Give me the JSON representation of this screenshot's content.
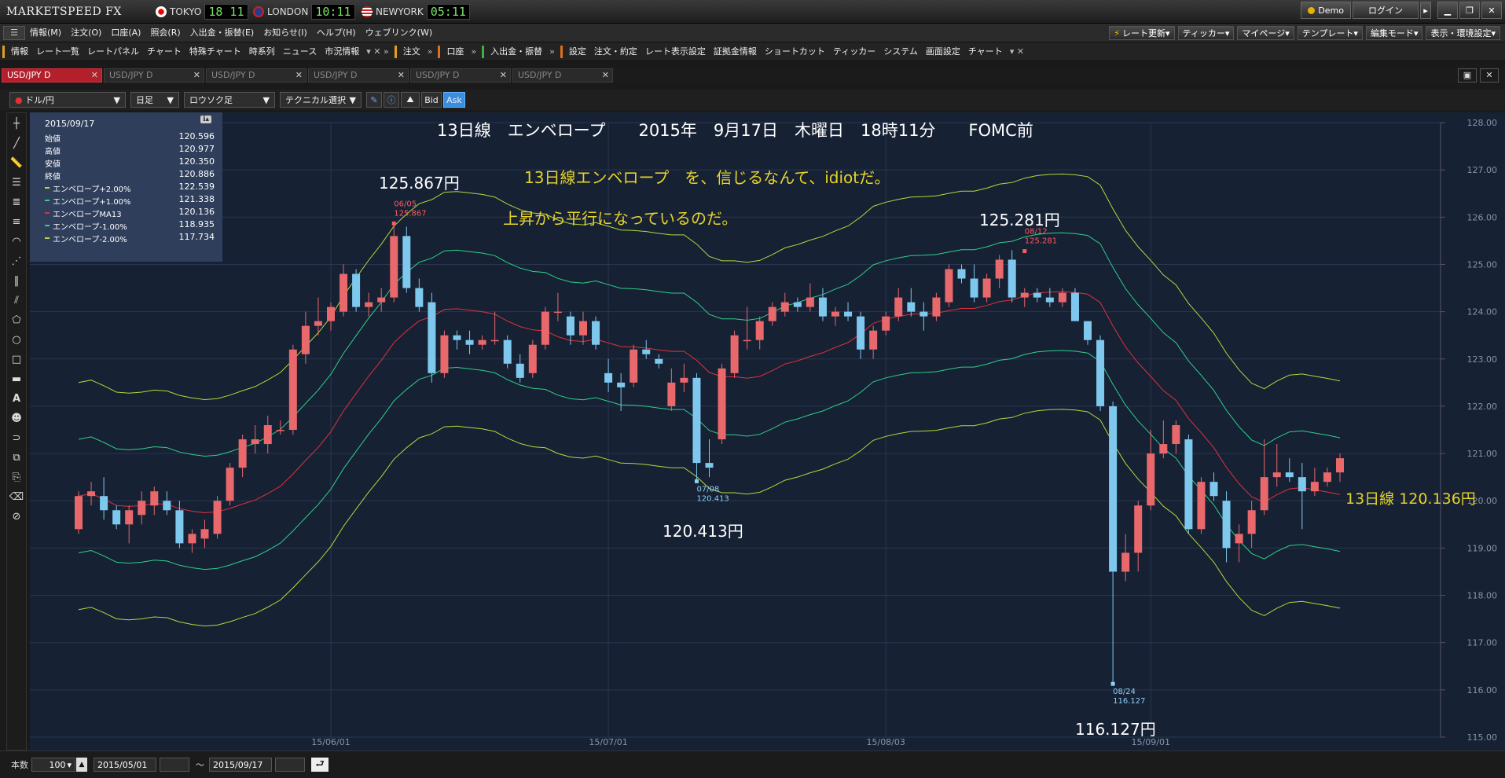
{
  "app": {
    "logo": "MARKETSPEED FX",
    "clocks": [
      {
        "city": "TOKYO",
        "time": "18 11"
      },
      {
        "city": "LONDON",
        "time": "10:11"
      },
      {
        "city": "NEWYORK",
        "time": "05:11"
      }
    ],
    "demo_label": "Demo",
    "login_label": "ログイン"
  },
  "menu": {
    "items": [
      "情報(M)",
      "注文(O)",
      "口座(A)",
      "照会(R)",
      "入出金・振替(E)",
      "お知らせ(I)",
      "ヘルプ(H)",
      "ウェブリンク(W)"
    ],
    "right_buttons": [
      "レート更新",
      "ティッカー",
      "マイページ",
      "テンプレート",
      "編集モード",
      "表示・環境設定"
    ]
  },
  "toolbar": {
    "groups": [
      {
        "color": "#e0a020",
        "items": [
          "情報",
          "レート一覧",
          "レートパネル",
          "チャート",
          "特殊チャート",
          "時系列",
          "ニュース",
          "市況情報"
        ]
      },
      {
        "color": "#e0a020",
        "items": [
          "注文"
        ]
      },
      {
        "color": "#e07020",
        "items": [
          "口座"
        ]
      },
      {
        "color": "#3cb043",
        "items": [
          "入出金・振替"
        ]
      },
      {
        "color": "#e07020",
        "items": [
          "設定",
          "注文・約定",
          "レート表示設定",
          "証拠金情報",
          "ショートカット",
          "ティッカー",
          "システム",
          "画面設定",
          "チャート"
        ]
      }
    ]
  },
  "tabs": [
    "USD/JPY D",
    "USD/JPY D",
    "USD/JPY D",
    "USD/JPY D",
    "USD/JPY D",
    "USD/JPY D"
  ],
  "chart_toolbar": {
    "pair": "ドル/円",
    "timeframe": "日足",
    "chart_style": "ロウソク足",
    "technical": "テクニカル選択",
    "bid": "Bid",
    "ask": "Ask"
  },
  "info_panel": {
    "date": "2015/09/17",
    "rows": [
      {
        "label": "始値",
        "value": "120.596",
        "color": ""
      },
      {
        "label": "高値",
        "value": "120.977",
        "color": ""
      },
      {
        "label": "安値",
        "value": "120.350",
        "color": ""
      },
      {
        "label": "終値",
        "value": "120.886",
        "color": ""
      },
      {
        "label": "エンベロープ+2.00%",
        "value": "122.539",
        "color": "#b5d83a"
      },
      {
        "label": "エンベロープ+1.00%",
        "value": "121.338",
        "color": "#2ed08a"
      },
      {
        "label": "エンベロープMA13",
        "value": "120.136",
        "color": "#e0303c"
      },
      {
        "label": "エンベロープ-1.00%",
        "value": "118.935",
        "color": "#2ed08a"
      },
      {
        "label": "エンベロープ-2.00%",
        "value": "117.734",
        "color": "#b5d83a"
      }
    ]
  },
  "annotations": {
    "title": "13日線　エンベロープ　　2015年　9月17日　木曜日　18時11分　　FOMC前",
    "comment1": "13日線エンベロープ　を、信じるなんて、idiotだ。",
    "comment2": "上昇から平行になっているのだ。",
    "high1": "125.867円",
    "high2": "125.281円",
    "low1": "120.413円",
    "low2": "116.127円",
    "ma_label": "13日線 120.136円",
    "marker_high1_date": "06/05",
    "marker_high1_val": "125.867",
    "marker_high2_date": "08/12",
    "marker_high2_val": "125.281",
    "marker_low1_date": "07/08",
    "marker_low1_val": "120.413",
    "marker_low2_date": "08/24",
    "marker_low2_val": "116.127"
  },
  "bottom": {
    "count_label": "本数",
    "count": "100",
    "from": "2015/05/01",
    "to": "2015/09/17",
    "tilde": "～"
  },
  "chart_data": {
    "type": "candlestick",
    "ylim": [
      115.0,
      128.0
    ],
    "yticks": [
      "115.00",
      "116.00",
      "117.00",
      "118.00",
      "119.00",
      "120.00",
      "121.00",
      "122.00",
      "123.00",
      "124.00",
      "125.00",
      "126.00",
      "127.00",
      "128.00"
    ],
    "xticks": [
      {
        "label": "15/06/01",
        "index": 20
      },
      {
        "label": "15/07/01",
        "index": 42
      },
      {
        "label": "15/08/03",
        "index": 64
      },
      {
        "label": "15/09/01",
        "index": 85
      }
    ],
    "colors": {
      "up": "#e8686c",
      "down": "#7ec8ee",
      "ma": "#e0303c",
      "env1": "#2ed08a",
      "env2": "#b5d83a"
    },
    "envelope_pct": [
      1,
      2
    ],
    "candles": [
      {
        "o": 119.4,
        "h": 120.2,
        "l": 119.3,
        "c": 120.1
      },
      {
        "o": 120.1,
        "h": 120.4,
        "l": 119.9,
        "c": 120.2
      },
      {
        "o": 120.1,
        "h": 120.5,
        "l": 119.6,
        "c": 119.8
      },
      {
        "o": 119.8,
        "h": 119.9,
        "l": 119.4,
        "c": 119.5
      },
      {
        "o": 119.5,
        "h": 119.9,
        "l": 119.1,
        "c": 119.8
      },
      {
        "o": 119.7,
        "h": 120.2,
        "l": 119.5,
        "c": 120.0
      },
      {
        "o": 119.9,
        "h": 120.3,
        "l": 119.7,
        "c": 120.2
      },
      {
        "o": 120.0,
        "h": 120.2,
        "l": 119.7,
        "c": 119.8
      },
      {
        "o": 119.8,
        "h": 120.0,
        "l": 119.0,
        "c": 119.1
      },
      {
        "o": 119.1,
        "h": 119.4,
        "l": 118.9,
        "c": 119.3
      },
      {
        "o": 119.2,
        "h": 119.6,
        "l": 119.0,
        "c": 119.4
      },
      {
        "o": 119.3,
        "h": 120.1,
        "l": 119.2,
        "c": 120.0
      },
      {
        "o": 120.0,
        "h": 120.8,
        "l": 119.9,
        "c": 120.7
      },
      {
        "o": 120.7,
        "h": 121.4,
        "l": 120.5,
        "c": 121.3
      },
      {
        "o": 121.2,
        "h": 121.6,
        "l": 121.0,
        "c": 121.3
      },
      {
        "o": 121.2,
        "h": 121.8,
        "l": 121.0,
        "c": 121.6
      },
      {
        "o": 121.5,
        "h": 121.7,
        "l": 121.4,
        "c": 121.5
      },
      {
        "o": 121.5,
        "h": 123.3,
        "l": 121.4,
        "c": 123.2
      },
      {
        "o": 123.1,
        "h": 124.0,
        "l": 122.9,
        "c": 123.7
      },
      {
        "o": 123.7,
        "h": 124.3,
        "l": 123.5,
        "c": 123.8
      },
      {
        "o": 123.8,
        "h": 124.2,
        "l": 123.6,
        "c": 124.1
      },
      {
        "o": 124.0,
        "h": 125.0,
        "l": 123.9,
        "c": 124.8
      },
      {
        "o": 124.8,
        "h": 124.9,
        "l": 124.0,
        "c": 124.1
      },
      {
        "o": 124.1,
        "h": 124.4,
        "l": 123.9,
        "c": 124.2
      },
      {
        "o": 124.2,
        "h": 124.5,
        "l": 124.0,
        "c": 124.3
      },
      {
        "o": 124.3,
        "h": 125.9,
        "l": 124.2,
        "c": 125.6
      },
      {
        "o": 125.6,
        "h": 125.8,
        "l": 124.4,
        "c": 124.5
      },
      {
        "o": 124.5,
        "h": 124.7,
        "l": 124.0,
        "c": 124.1
      },
      {
        "o": 124.2,
        "h": 124.4,
        "l": 122.5,
        "c": 122.7
      },
      {
        "o": 122.7,
        "h": 123.6,
        "l": 122.6,
        "c": 123.5
      },
      {
        "o": 123.5,
        "h": 123.6,
        "l": 123.2,
        "c": 123.4
      },
      {
        "o": 123.4,
        "h": 123.6,
        "l": 123.1,
        "c": 123.3
      },
      {
        "o": 123.3,
        "h": 123.5,
        "l": 123.2,
        "c": 123.4
      },
      {
        "o": 123.4,
        "h": 124.0,
        "l": 123.3,
        "c": 123.4
      },
      {
        "o": 123.4,
        "h": 123.5,
        "l": 122.8,
        "c": 122.9
      },
      {
        "o": 122.9,
        "h": 123.1,
        "l": 122.5,
        "c": 122.6
      },
      {
        "o": 122.7,
        "h": 123.4,
        "l": 122.6,
        "c": 123.3
      },
      {
        "o": 123.3,
        "h": 124.1,
        "l": 123.2,
        "c": 124.0
      },
      {
        "o": 124.0,
        "h": 124.4,
        "l": 123.8,
        "c": 124.0
      },
      {
        "o": 123.9,
        "h": 124.0,
        "l": 123.3,
        "c": 123.5
      },
      {
        "o": 123.5,
        "h": 124.0,
        "l": 123.3,
        "c": 123.8
      },
      {
        "o": 123.8,
        "h": 123.9,
        "l": 123.2,
        "c": 123.3
      },
      {
        "o": 122.7,
        "h": 123.0,
        "l": 122.3,
        "c": 122.5
      },
      {
        "o": 122.5,
        "h": 122.7,
        "l": 121.9,
        "c": 122.4
      },
      {
        "o": 122.5,
        "h": 123.3,
        "l": 122.4,
        "c": 123.2
      },
      {
        "o": 123.2,
        "h": 123.4,
        "l": 123.0,
        "c": 123.1
      },
      {
        "o": 123.0,
        "h": 123.1,
        "l": 122.8,
        "c": 122.9
      },
      {
        "o": 122.0,
        "h": 122.8,
        "l": 121.9,
        "c": 122.5
      },
      {
        "o": 122.5,
        "h": 122.9,
        "l": 122.3,
        "c": 122.6
      },
      {
        "o": 122.6,
        "h": 122.7,
        "l": 120.4,
        "c": 120.8
      },
      {
        "o": 120.8,
        "h": 121.3,
        "l": 120.5,
        "c": 120.7
      },
      {
        "o": 121.3,
        "h": 122.9,
        "l": 121.2,
        "c": 122.8
      },
      {
        "o": 122.7,
        "h": 123.6,
        "l": 122.6,
        "c": 123.5
      },
      {
        "o": 123.4,
        "h": 124.1,
        "l": 123.2,
        "c": 123.4
      },
      {
        "o": 123.4,
        "h": 123.9,
        "l": 123.2,
        "c": 123.8
      },
      {
        "o": 123.8,
        "h": 124.2,
        "l": 123.7,
        "c": 124.1
      },
      {
        "o": 124.0,
        "h": 124.4,
        "l": 123.9,
        "c": 124.2
      },
      {
        "o": 124.2,
        "h": 124.3,
        "l": 124.0,
        "c": 124.1
      },
      {
        "o": 124.1,
        "h": 124.6,
        "l": 124.0,
        "c": 124.3
      },
      {
        "o": 124.3,
        "h": 124.5,
        "l": 123.8,
        "c": 123.9
      },
      {
        "o": 123.9,
        "h": 124.1,
        "l": 123.7,
        "c": 124.0
      },
      {
        "o": 124.0,
        "h": 124.2,
        "l": 123.8,
        "c": 123.9
      },
      {
        "o": 123.9,
        "h": 124.0,
        "l": 123.0,
        "c": 123.2
      },
      {
        "o": 123.2,
        "h": 123.7,
        "l": 123.0,
        "c": 123.6
      },
      {
        "o": 123.6,
        "h": 124.0,
        "l": 123.5,
        "c": 123.9
      },
      {
        "o": 123.9,
        "h": 124.5,
        "l": 123.8,
        "c": 124.3
      },
      {
        "o": 124.2,
        "h": 124.5,
        "l": 123.9,
        "c": 124.0
      },
      {
        "o": 124.0,
        "h": 124.2,
        "l": 123.6,
        "c": 123.9
      },
      {
        "o": 123.9,
        "h": 124.4,
        "l": 123.8,
        "c": 124.3
      },
      {
        "o": 124.2,
        "h": 125.0,
        "l": 124.1,
        "c": 124.9
      },
      {
        "o": 124.9,
        "h": 125.0,
        "l": 124.6,
        "c": 124.7
      },
      {
        "o": 124.7,
        "h": 125.0,
        "l": 124.2,
        "c": 124.3
      },
      {
        "o": 124.3,
        "h": 124.8,
        "l": 124.2,
        "c": 124.7
      },
      {
        "o": 124.7,
        "h": 125.2,
        "l": 124.5,
        "c": 125.1
      },
      {
        "o": 125.1,
        "h": 125.3,
        "l": 124.2,
        "c": 124.3
      },
      {
        "o": 124.3,
        "h": 124.5,
        "l": 124.1,
        "c": 124.4
      },
      {
        "o": 124.4,
        "h": 124.5,
        "l": 124.2,
        "c": 124.3
      },
      {
        "o": 124.3,
        "h": 124.5,
        "l": 124.1,
        "c": 124.2
      },
      {
        "o": 124.2,
        "h": 124.5,
        "l": 124.1,
        "c": 124.4
      },
      {
        "o": 124.4,
        "h": 124.5,
        "l": 123.8,
        "c": 123.8
      },
      {
        "o": 123.8,
        "h": 123.8,
        "l": 123.3,
        "c": 123.4
      },
      {
        "o": 123.4,
        "h": 123.5,
        "l": 121.9,
        "c": 122.0
      },
      {
        "o": 122.0,
        "h": 122.1,
        "l": 116.1,
        "c": 118.5
      },
      {
        "o": 118.5,
        "h": 119.3,
        "l": 118.3,
        "c": 118.9
      },
      {
        "o": 118.9,
        "h": 120.0,
        "l": 118.5,
        "c": 119.9
      },
      {
        "o": 119.9,
        "h": 121.5,
        "l": 119.8,
        "c": 121.0
      },
      {
        "o": 121.0,
        "h": 121.7,
        "l": 120.9,
        "c": 121.2
      },
      {
        "o": 121.2,
        "h": 121.7,
        "l": 121.0,
        "c": 121.6
      },
      {
        "o": 121.3,
        "h": 121.4,
        "l": 119.3,
        "c": 119.4
      },
      {
        "o": 119.4,
        "h": 120.5,
        "l": 119.3,
        "c": 120.4
      },
      {
        "o": 120.4,
        "h": 120.6,
        "l": 120.0,
        "c": 120.1
      },
      {
        "o": 120.0,
        "h": 120.2,
        "l": 118.7,
        "c": 119.0
      },
      {
        "o": 119.1,
        "h": 119.5,
        "l": 118.7,
        "c": 119.3
      },
      {
        "o": 119.3,
        "h": 120.0,
        "l": 119.0,
        "c": 119.8
      },
      {
        "o": 119.8,
        "h": 121.3,
        "l": 119.7,
        "c": 120.5
      },
      {
        "o": 120.5,
        "h": 121.2,
        "l": 120.3,
        "c": 120.6
      },
      {
        "o": 120.6,
        "h": 120.9,
        "l": 120.4,
        "c": 120.5
      },
      {
        "o": 120.5,
        "h": 120.8,
        "l": 119.4,
        "c": 120.2
      },
      {
        "o": 120.2,
        "h": 120.7,
        "l": 120.1,
        "c": 120.4
      },
      {
        "o": 120.4,
        "h": 120.7,
        "l": 120.3,
        "c": 120.6
      },
      {
        "o": 120.6,
        "h": 121.0,
        "l": 120.4,
        "c": 120.9
      }
    ]
  }
}
